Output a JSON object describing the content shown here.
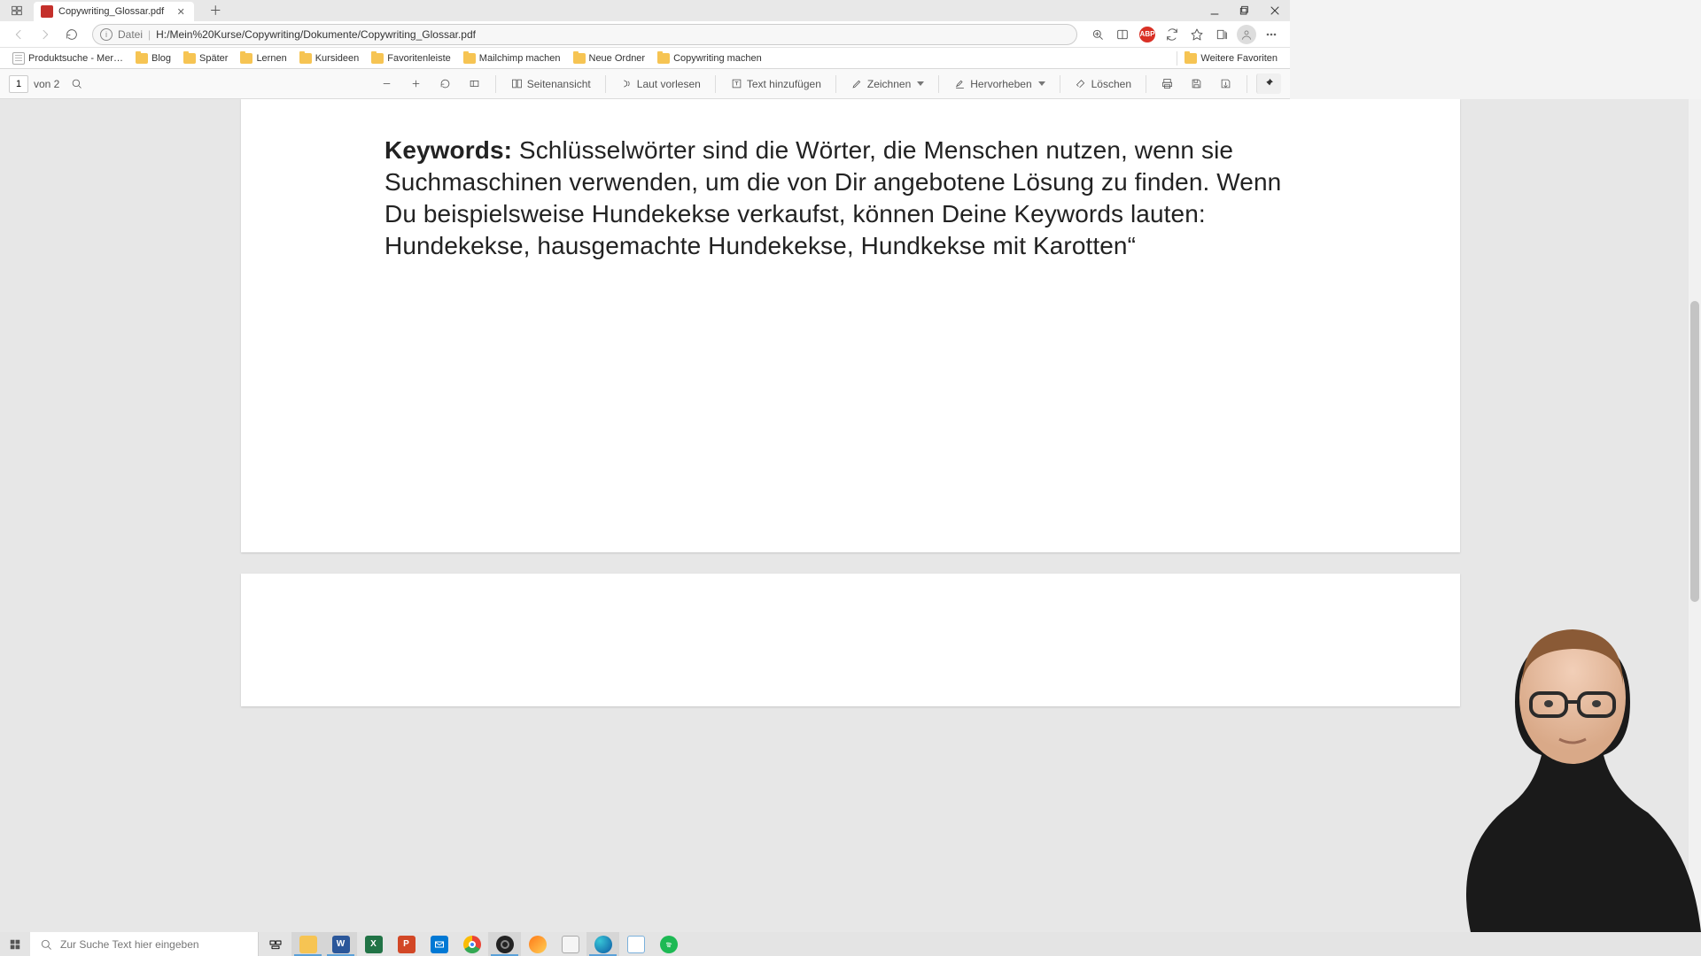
{
  "tab": {
    "title": "Copywriting_Glossar.pdf"
  },
  "address": {
    "scheme": "Datei",
    "path": "H:/Mein%20Kurse/Copywriting/Dokumente/Copywriting_Glossar.pdf"
  },
  "bookmarks": {
    "item0": "Produktsuche - Mer…",
    "folders": [
      "Blog",
      "Später",
      "Lernen",
      "Kursideen",
      "Favoritenleiste",
      "Mailchimp machen",
      "Neue Ordner",
      "Copywriting machen"
    ],
    "more_label": "Weitere Favoriten"
  },
  "pdfbar": {
    "page_current": "1",
    "page_total_label": "von 2",
    "page_view": "Seitenansicht",
    "read_aloud": "Laut vorlesen",
    "add_text": "Text hinzufügen",
    "draw": "Zeichnen",
    "highlight": "Hervorheben",
    "erase": "Löschen"
  },
  "document": {
    "kw_label": "Keywords:",
    "kw_body": " Schlüsselwörter sind die Wörter, die Menschen nutzen, wenn sie Suchmaschinen verwenden, um die von Dir angebotene Lösung zu finden. Wenn Du beispielsweise Hundekekse verkaufst, können Deine Keywords lauten: Hundekekse, hausgemachte Hundekekse, Hundkekse mit Karotten“"
  },
  "taskbar": {
    "search_placeholder": "Zur Suche Text hier eingeben"
  }
}
